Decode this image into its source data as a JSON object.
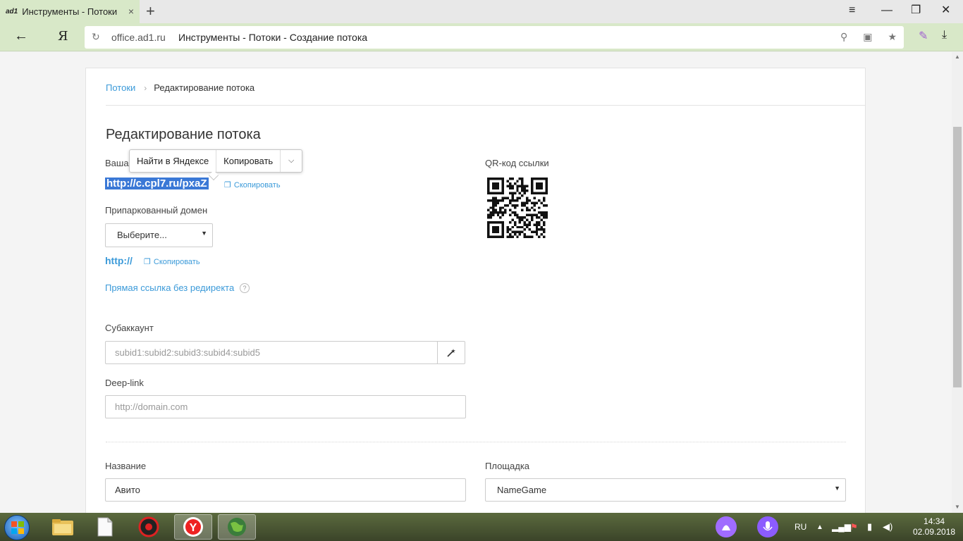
{
  "browser": {
    "tab": {
      "favicon": "ad1",
      "title": "Инструменты - Потоки",
      "close_icon": "×"
    },
    "new_tab_icon": "+",
    "window_controls": {
      "menu": "≡",
      "minimize": "—",
      "restore": "❐",
      "close": "✕"
    },
    "back_icon": "←",
    "yandex_button": "Я",
    "reload_icon": "↻",
    "address_domain": "office.ad1.ru",
    "address_title": "Инструменты - Потоки - Создание потока",
    "omni_icons": {
      "search": "⚲",
      "protect": "▣",
      "bookmark": "★"
    },
    "pen_icon": "✎",
    "download_icon": "⤓"
  },
  "breadcrumb": {
    "root": "Потоки",
    "separator": "›",
    "current": "Редактирование потока"
  },
  "page_title": "Редактирование потока",
  "link_section": {
    "label_prefix": "Ваша",
    "link": "http://c.cpl7.ru/pxaZ",
    "copy_label": "Скопировать"
  },
  "context_popup": {
    "search": "Найти в Яндексе",
    "copy": "Копировать",
    "more_icon": "⌵"
  },
  "qr": {
    "label": "QR-код ссылки"
  },
  "parked_domain": {
    "label": "Припаркованный домен",
    "select_value": "Выберите...",
    "caret": "▼",
    "link": "http://",
    "copy_label": "Скопировать"
  },
  "direct_link": {
    "label": "Прямая ссылка без редиректа",
    "help_icon": "?"
  },
  "subaccount": {
    "label": "Субаккаунт",
    "placeholder": "subid1:subid2:subid3:subid4:subid5",
    "wand_icon": "⁄"
  },
  "deeplink": {
    "label": "Deep-link",
    "placeholder": "http://domain.com"
  },
  "name_field": {
    "label": "Название",
    "value": "Авито"
  },
  "platform_field": {
    "label": "Площадка",
    "value": "NameGame",
    "caret": "▼"
  },
  "taskbar": {
    "lang": "RU",
    "time": "14:34",
    "date": "02.09.2018"
  },
  "colors": {
    "accent": "#3b9ad9",
    "selection": "#3a78d6",
    "browser_chrome": "#d8e8c8"
  }
}
